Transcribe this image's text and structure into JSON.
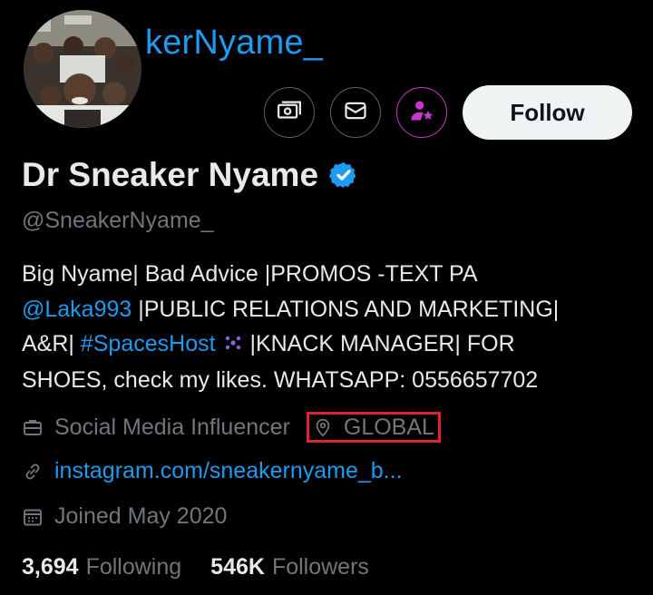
{
  "header": {
    "handle_overlay": "kerNyame_"
  },
  "actions": {
    "follow_label": "Follow"
  },
  "profile": {
    "display_name": "Dr Sneaker Nyame",
    "username": "@SneakerNyame_",
    "bio": {
      "line1": "Big Nyame| Bad Advice |PROMOS -TEXT PA",
      "line2_link": "@Laka993",
      "line2_rest": " |PUBLIC RELATIONS AND MARKETING|",
      "line3_start": "A&R| ",
      "line3_hashtag": "#SpacesHost",
      "line3_rest": "  |KNACK MANAGER| FOR",
      "line4": "SHOES, check my likes. WHATSAPP: 0556657702"
    },
    "profession": "Social Media Influencer",
    "location": "GLOBAL",
    "website": "instagram.com/sneakernyame_b...",
    "joined": "Joined May 2020"
  },
  "stats": {
    "following_count": "3,694",
    "following_label": "Following",
    "followers_count": "546K",
    "followers_label": "Followers"
  },
  "colors": {
    "background": "#000000",
    "accent": "#1d9bf0",
    "secondary_text": "#71767b",
    "highlight_box": "#e0242e",
    "subscribe_ring": "#c936cc"
  },
  "icons": {
    "tip": "money-icon",
    "message": "envelope-icon",
    "subscribe": "person-star-icon",
    "verified": "verified-badge-icon",
    "profession": "briefcase-icon",
    "location": "location-pin-icon",
    "website": "link-icon",
    "joined": "calendar-icon",
    "spaces": "spaces-sparkle-icon"
  }
}
